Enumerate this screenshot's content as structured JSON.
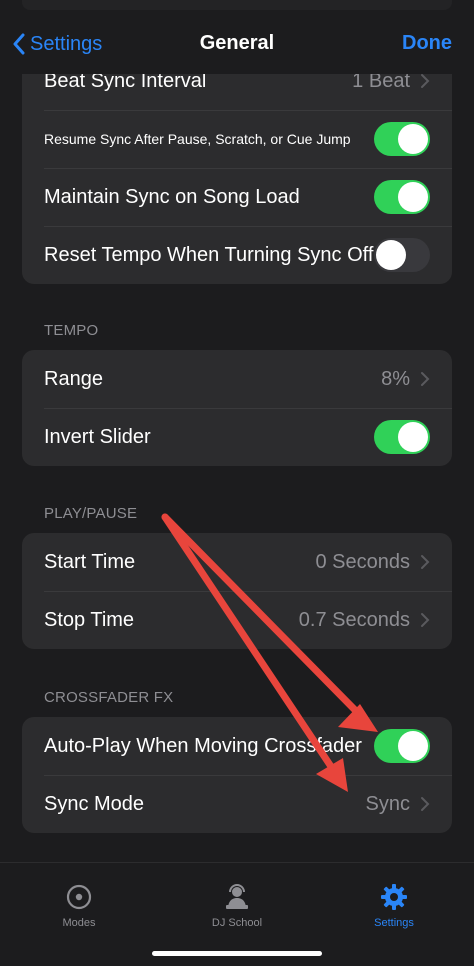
{
  "nav": {
    "back_label": "Settings",
    "title": "General",
    "done_label": "Done"
  },
  "sync_group": {
    "rows": [
      {
        "label": "Beat Sync Interval",
        "value": "1 Beat"
      },
      {
        "label": "Resume Sync After Pause, Scratch, or Cue Jump",
        "toggle": "on"
      },
      {
        "label": "Maintain Sync on Song Load",
        "toggle": "on"
      },
      {
        "label": "Reset Tempo When Turning Sync Off",
        "toggle": "off"
      }
    ]
  },
  "tempo": {
    "header": "TEMPO",
    "rows": [
      {
        "label": "Range",
        "value": "8%"
      },
      {
        "label": "Invert Slider",
        "toggle": "on"
      }
    ]
  },
  "play_pause": {
    "header": "PLAY/PAUSE",
    "rows": [
      {
        "label": "Start Time",
        "value": "0 Seconds"
      },
      {
        "label": "Stop Time",
        "value": "0.7 Seconds"
      }
    ]
  },
  "crossfader_fx": {
    "header": "CROSSFADER FX",
    "rows": [
      {
        "label": "Auto-Play When Moving Crossfader",
        "toggle": "on"
      },
      {
        "label": "Sync Mode",
        "value": "Sync"
      }
    ]
  },
  "tabbar": {
    "items": [
      {
        "label": "Modes",
        "icon": "modes-icon"
      },
      {
        "label": "DJ School",
        "icon": "dj-school-icon"
      },
      {
        "label": "Settings",
        "icon": "gear-icon",
        "active": true
      }
    ]
  },
  "colors": {
    "accent": "#2a85f7",
    "toggle_on": "#30d158",
    "annotation_arrow": "#e8453c"
  }
}
